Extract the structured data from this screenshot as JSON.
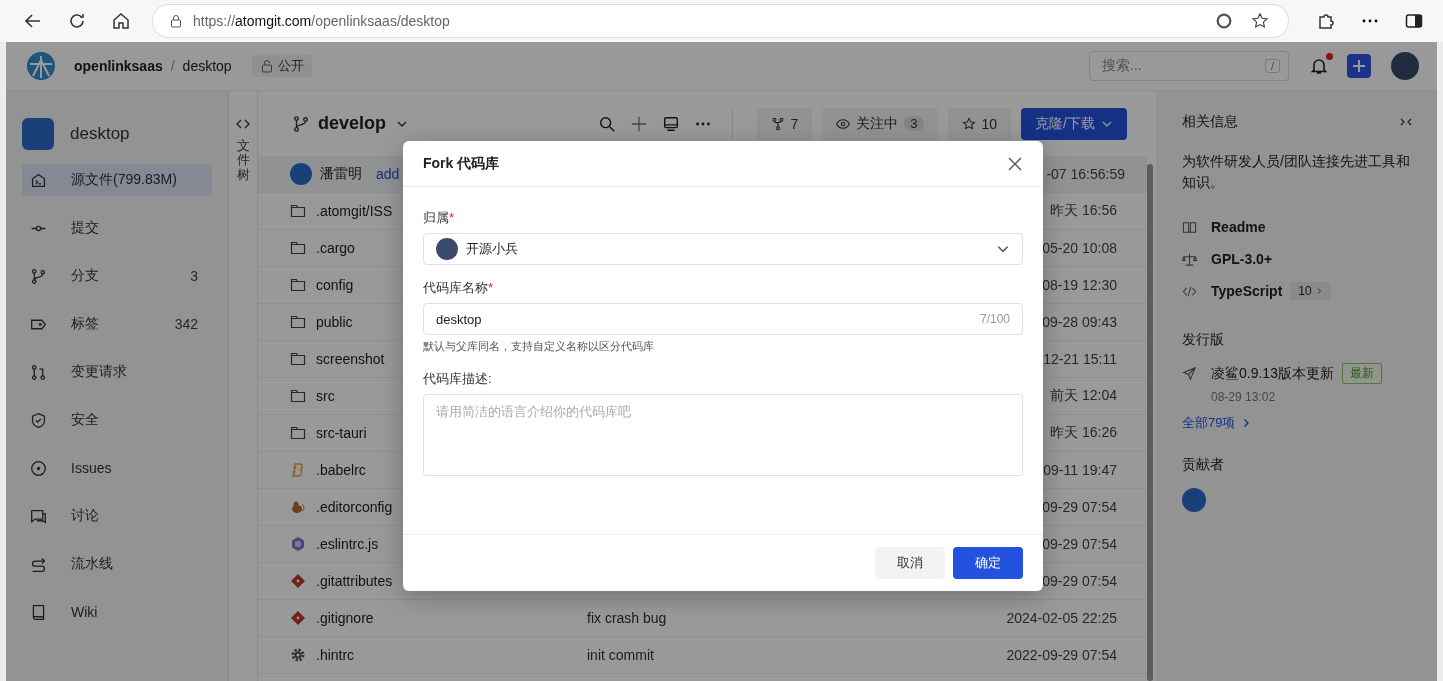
{
  "browser": {
    "url": {
      "prefix": "https://",
      "domain": "atomgit.com",
      "path": "/openlinksaas/desktop"
    }
  },
  "header": {
    "owner": "openlinksaas",
    "separator": "/",
    "repo": "desktop",
    "visibility": "公开",
    "search_placeholder": "搜索...",
    "shortcut": "/",
    "has_unread": true
  },
  "sidebar": {
    "repo_name": "desktop",
    "items": [
      {
        "kind": "code",
        "label": "源文件(799.83M)",
        "selected": true
      },
      {
        "kind": "commit",
        "label": "提交",
        "selected": false
      },
      {
        "kind": "branch",
        "label": "分支",
        "count": "3",
        "selected": false
      },
      {
        "kind": "tag",
        "label": "标签",
        "count": "342",
        "selected": false
      },
      {
        "kind": "merge",
        "label": "变更请求",
        "selected": false
      },
      {
        "kind": "shield",
        "label": "安全",
        "selected": false
      },
      {
        "kind": "issue",
        "label": "Issues",
        "selected": false
      },
      {
        "kind": "chat",
        "label": "讨论",
        "selected": false
      },
      {
        "kind": "pipeline",
        "label": "流水线",
        "selected": false
      },
      {
        "kind": "book",
        "label": "Wiki",
        "selected": false
      }
    ]
  },
  "file_tree_toggle": {
    "label": "文件树"
  },
  "toolbar": {
    "branch": "develop",
    "forks": "7",
    "watch": {
      "label": "关注中",
      "count": "3"
    },
    "stars": "10",
    "clone": "克隆/下载"
  },
  "commit": {
    "author": "潘雷明",
    "message": "add",
    "date": "-07 16:56:59"
  },
  "files": [
    {
      "kind": "folder",
      "name": ".atomgit/ISS",
      "date": "昨天 16:56"
    },
    {
      "kind": "folder",
      "name": ".cargo",
      "date": "05-20 10:08"
    },
    {
      "kind": "folder",
      "name": "config",
      "date": "08-19 12:30"
    },
    {
      "kind": "folder",
      "name": "public",
      "date": "09-28 09:43"
    },
    {
      "kind": "folder",
      "name": "screenshot",
      "date": "12-21 15:11"
    },
    {
      "kind": "folder",
      "name": "src",
      "date": "前天 12:04"
    },
    {
      "kind": "folder",
      "name": "src-tauri",
      "date": "昨天 16:26"
    },
    {
      "kind": "babel",
      "name": ".babelrc",
      "date": "09-11 19:47"
    },
    {
      "kind": "editorconfig",
      "name": ".editorconfig",
      "date": "09-29 07:54"
    },
    {
      "kind": "eslint",
      "name": ".eslintrc.js",
      "date": "09-29 07:54"
    },
    {
      "kind": "git",
      "name": ".gitattributes",
      "date": "09-29 07:54"
    },
    {
      "kind": "git",
      "name": ".gitignore",
      "message": "fix crash bug",
      "date": "2024-02-05 22:25"
    },
    {
      "kind": "gear",
      "name": ".hintrc",
      "message": "init commit",
      "date": "2022-09-29 07:54"
    }
  ],
  "info": {
    "title": "相关信息",
    "description": "为软件研发人员/团队连接先进工具和知识。",
    "links": [
      {
        "kind": "book",
        "label": "Readme"
      },
      {
        "kind": "scale",
        "label": "GPL-3.0+"
      },
      {
        "kind": "code",
        "label": "TypeScript",
        "count": "10"
      }
    ],
    "releases_title": "发行版",
    "release": {
      "name": "凌鲨0.9.13版本更新",
      "badge": "最新",
      "date": "08-29 13:02"
    },
    "all_releases": "全部79项",
    "contributors_title": "贡献者"
  },
  "modal": {
    "title": "Fork 代码库",
    "owner_label": "归属",
    "owner_required": "*",
    "owner_value": "开源小兵",
    "name_label": "代码库名称",
    "name_required": "*",
    "name_value": "desktop",
    "name_counter": "7/100",
    "name_help": "默认与父库同名，支持自定义名称以区分代码库",
    "desc_label": "代码库描述:",
    "desc_placeholder": "请用简洁的语言介绍你的代码库吧",
    "cancel": "取消",
    "confirm": "确定"
  }
}
